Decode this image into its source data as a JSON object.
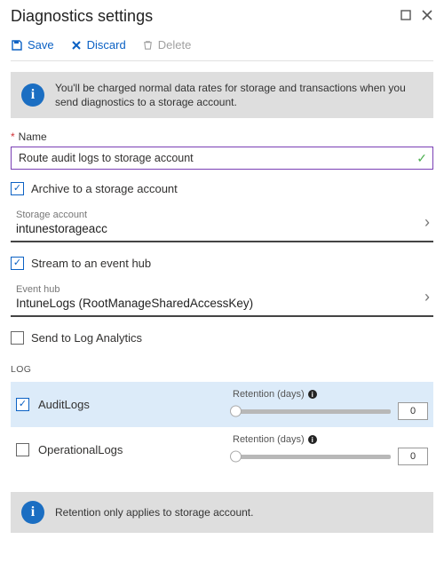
{
  "header": {
    "title": "Diagnostics settings"
  },
  "toolbar": {
    "save_label": "Save",
    "discard_label": "Discard",
    "delete_label": "Delete"
  },
  "info_banner": "You'll be charged normal data rates for storage and transactions when you send diagnostics to a storage account.",
  "name_field": {
    "label": "Name",
    "value": "Route audit logs to storage account"
  },
  "archive": {
    "label": "Archive to a storage account",
    "checked": true,
    "selector_label": "Storage account",
    "selector_value": "intunestorageacc"
  },
  "stream": {
    "label": "Stream to an event hub",
    "checked": true,
    "selector_label": "Event hub",
    "selector_value": "IntuneLogs (RootManageSharedAccessKey)"
  },
  "log_analytics": {
    "label": "Send to Log Analytics",
    "checked": false
  },
  "log_section_title": "LOG",
  "retention_label": "Retention (days)",
  "logs": [
    {
      "name": "AuditLogs",
      "checked": true,
      "retention": "0",
      "selected": true
    },
    {
      "name": "OperationalLogs",
      "checked": false,
      "retention": "0",
      "selected": false
    }
  ],
  "footer_info": "Retention only applies to storage account."
}
